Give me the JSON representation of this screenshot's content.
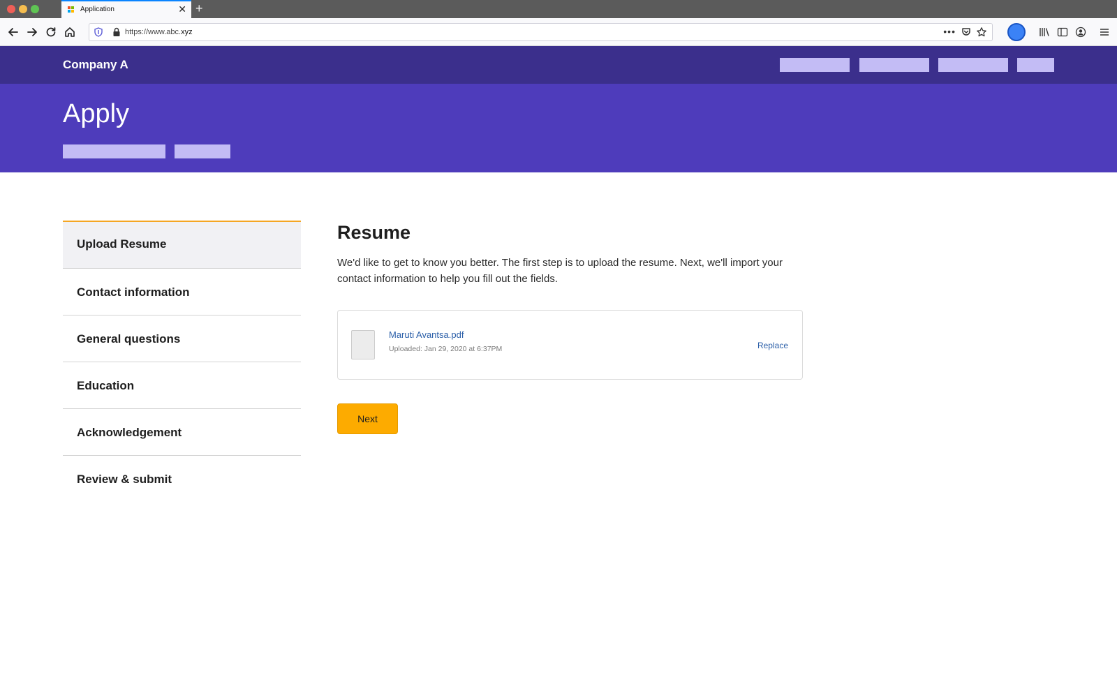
{
  "browser": {
    "tab_title": "Application",
    "tab_close": "✕",
    "new_tab": "+",
    "url_host_prefix": "https://www.abc.",
    "url_host_tld": "xyz",
    "url_more": "•••"
  },
  "site": {
    "brand": "Company A",
    "hero_title": "Apply"
  },
  "steps": [
    {
      "label": "Upload Resume",
      "active": true
    },
    {
      "label": "Contact information",
      "active": false
    },
    {
      "label": "General questions",
      "active": false
    },
    {
      "label": "Education",
      "active": false
    },
    {
      "label": "Acknowledgement",
      "active": false
    },
    {
      "label": "Review & submit",
      "active": false
    }
  ],
  "main": {
    "title": "Resume",
    "description": "We'd like to get to know you better. The first step is to upload the resume. Next, we'll import your contact information to help you fill out the fields.",
    "file": {
      "name": "Maruti Avantsa.pdf",
      "meta": "Uploaded: Jan 29, 2020 at 6:37PM",
      "replace_label": "Replace"
    },
    "next_label": "Next"
  },
  "colors": {
    "header_dark": "#3b2f8c",
    "hero": "#4e3cbb",
    "placeholder": "#c3bcf5",
    "accent": "#fdab00",
    "active_border": "#f5a623",
    "link": "#2b5fa8"
  },
  "icons": {
    "back": "arrow-left-icon",
    "forward": "arrow-right-icon",
    "reload": "reload-icon",
    "home": "home-icon",
    "shield": "shield-icon",
    "lock": "lock-icon",
    "pocket": "pocket-icon",
    "star": "star-icon",
    "library": "library-icon",
    "sidebar": "sidebar-icon",
    "account": "account-icon",
    "menu": "hamburger-menu-icon",
    "file": "file-icon"
  }
}
